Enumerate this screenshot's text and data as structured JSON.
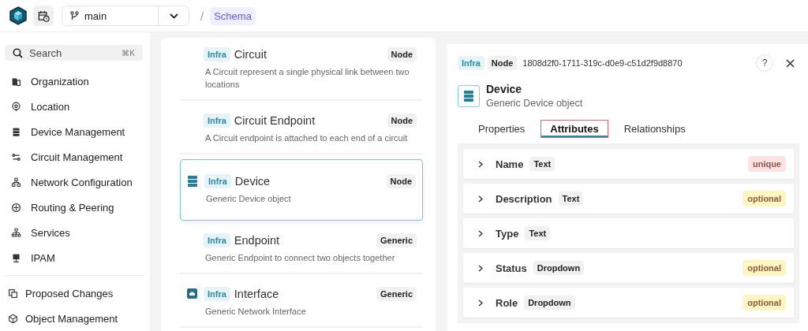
{
  "topbar": {
    "branch": "main",
    "separator": "/",
    "breadcrumb": "Schema"
  },
  "sidebar": {
    "search": {
      "placeholder": "Search",
      "shortcut": "⌘K"
    },
    "items": [
      {
        "label": "Organization",
        "kind": "building"
      },
      {
        "label": "Location",
        "kind": "pin"
      },
      {
        "label": "Device Management",
        "kind": "server"
      },
      {
        "label": "Circuit Management",
        "kind": "circuit"
      },
      {
        "label": "Network Configuration",
        "kind": "network"
      },
      {
        "label": "Routing & Peering",
        "kind": "routing"
      },
      {
        "label": "Services",
        "kind": "tree"
      },
      {
        "label": "IPAM",
        "kind": "monitor"
      }
    ],
    "bottom_items": [
      {
        "label": "Proposed Changes",
        "kind": "changes"
      },
      {
        "label": "Object Management",
        "kind": "cube"
      }
    ]
  },
  "schema_list": [
    {
      "namespace": "Infra",
      "name": "Circuit",
      "type": "Node",
      "description": "A Circuit represent a single physical link between two locations",
      "kind": "plain",
      "selected": false
    },
    {
      "namespace": "Infra",
      "name": "Circuit Endpoint",
      "type": "Node",
      "description": "A Circuit endpoint is attached to each end of a circuit",
      "kind": "plain",
      "selected": false
    },
    {
      "namespace": "Infra",
      "name": "Device",
      "type": "Node",
      "description": "Generic Device object",
      "kind": "server",
      "selected": true
    },
    {
      "namespace": "Infra",
      "name": "Endpoint",
      "type": "Generic",
      "description": "Generic Endpoint to connect two objects together",
      "kind": "plain",
      "selected": false
    },
    {
      "namespace": "Infra",
      "name": "Interface",
      "type": "Generic",
      "description": "Generic Network Interface",
      "kind": "port",
      "selected": false
    }
  ],
  "detail": {
    "namespace": "Infra",
    "type": "Node",
    "id": "1808d2f0-1711-319c-d0e9-c51d2f9d8870",
    "help": "?",
    "title": "Device",
    "description": "Generic Device object",
    "tabs": [
      {
        "label": "Properties",
        "selected": false,
        "outlined": false
      },
      {
        "label": "Attributes",
        "selected": true,
        "outlined": true
      },
      {
        "label": "Relationships",
        "selected": false,
        "outlined": false
      }
    ],
    "attributes": [
      {
        "name": "Name",
        "type": "Text",
        "badge": "unique",
        "color": "#fde3e3",
        "expanded": false
      },
      {
        "name": "Description",
        "type": "Text",
        "badge": "optional",
        "color": "#fdf5c2",
        "expanded": false
      },
      {
        "name": "Type",
        "type": "Text",
        "expanded": false
      },
      {
        "name": "Status",
        "type": "Dropdown",
        "badge": "optional",
        "color": "#fdf5c2",
        "expanded": false
      },
      {
        "name": "Role",
        "type": "Dropdown",
        "badge": "optional",
        "color": "#fdf5c2",
        "expanded": false
      }
    ]
  }
}
